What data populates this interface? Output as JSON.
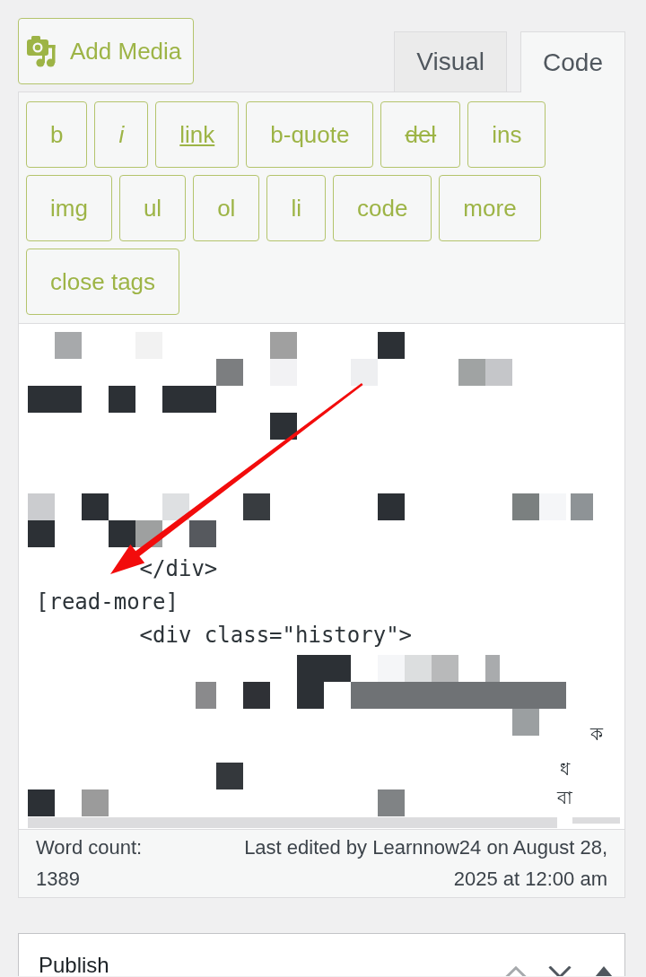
{
  "media_button": {
    "label": "Add Media"
  },
  "editor_tabs": [
    {
      "label": "Visual",
      "selected": false
    },
    {
      "label": "Code",
      "selected": true
    }
  ],
  "quicktags": [
    {
      "label": "b",
      "kind": "plain"
    },
    {
      "label": "i",
      "kind": "italic"
    },
    {
      "label": "link",
      "kind": "underline"
    },
    {
      "label": "b-quote",
      "kind": "plain"
    },
    {
      "label": "del",
      "kind": "strike"
    },
    {
      "label": "ins",
      "kind": "plain"
    },
    {
      "label": "img",
      "kind": "plain"
    },
    {
      "label": "ul",
      "kind": "plain"
    },
    {
      "label": "ol",
      "kind": "plain"
    },
    {
      "label": "li",
      "kind": "plain"
    },
    {
      "label": "code",
      "kind": "plain"
    },
    {
      "label": "more",
      "kind": "plain"
    },
    {
      "label": "close tags",
      "kind": "plain"
    }
  ],
  "code_lines": [
    "        </div>",
    "[read-more]",
    "        <div class=\"history\">"
  ],
  "text_fragments": [
    "ক",
    "ধ",
    "বা"
  ],
  "status_bar": {
    "word_count_label": "Word count:",
    "word_count": "1389",
    "last_edited": "Last edited by Learnnow24 on August 28, 2025 at 12:00 am"
  },
  "publish_box": {
    "title": "Publish"
  }
}
